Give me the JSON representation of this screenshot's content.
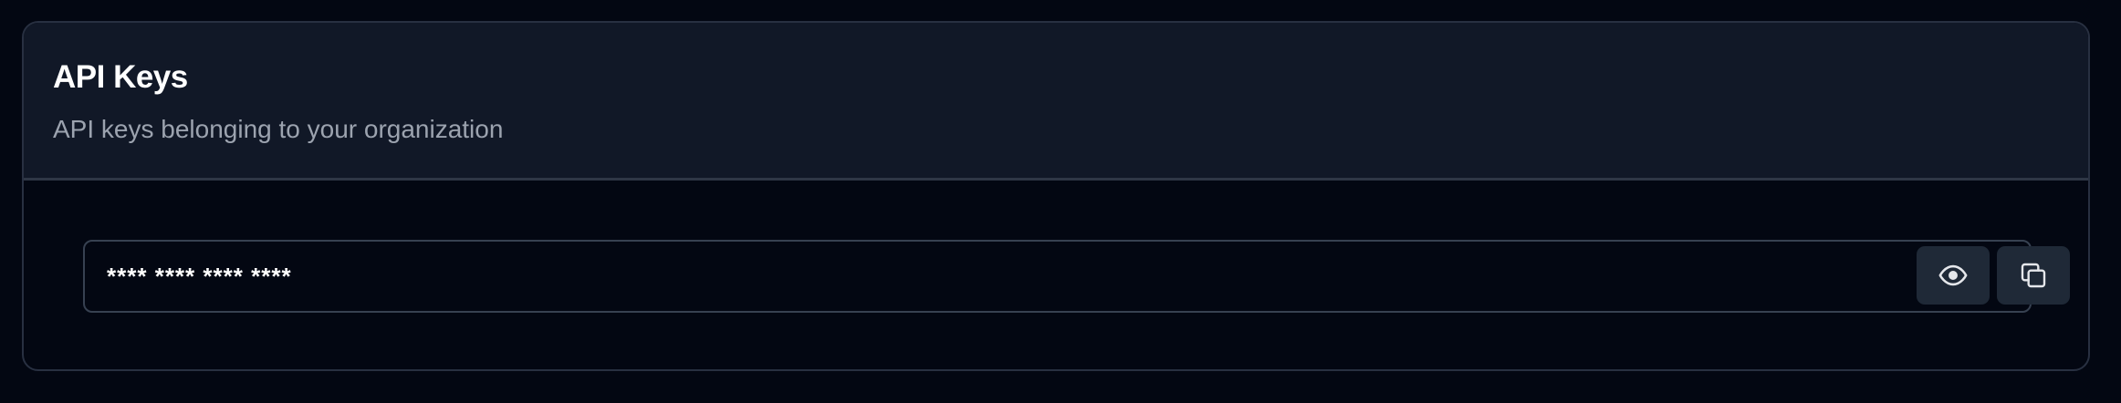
{
  "card": {
    "title": "API Keys",
    "subtitle": "API keys belonging to your organization"
  },
  "api_key": {
    "masked_value": "**** **** **** ****"
  },
  "icons": {
    "reveal": "eye-icon",
    "copy": "copy-icon"
  },
  "colors": {
    "page_background": "#030712",
    "header_background": "#111827",
    "button_background": "#1f2937",
    "border": "#374151",
    "title_text": "#ffffff",
    "subtitle_text": "#9ca3af"
  }
}
